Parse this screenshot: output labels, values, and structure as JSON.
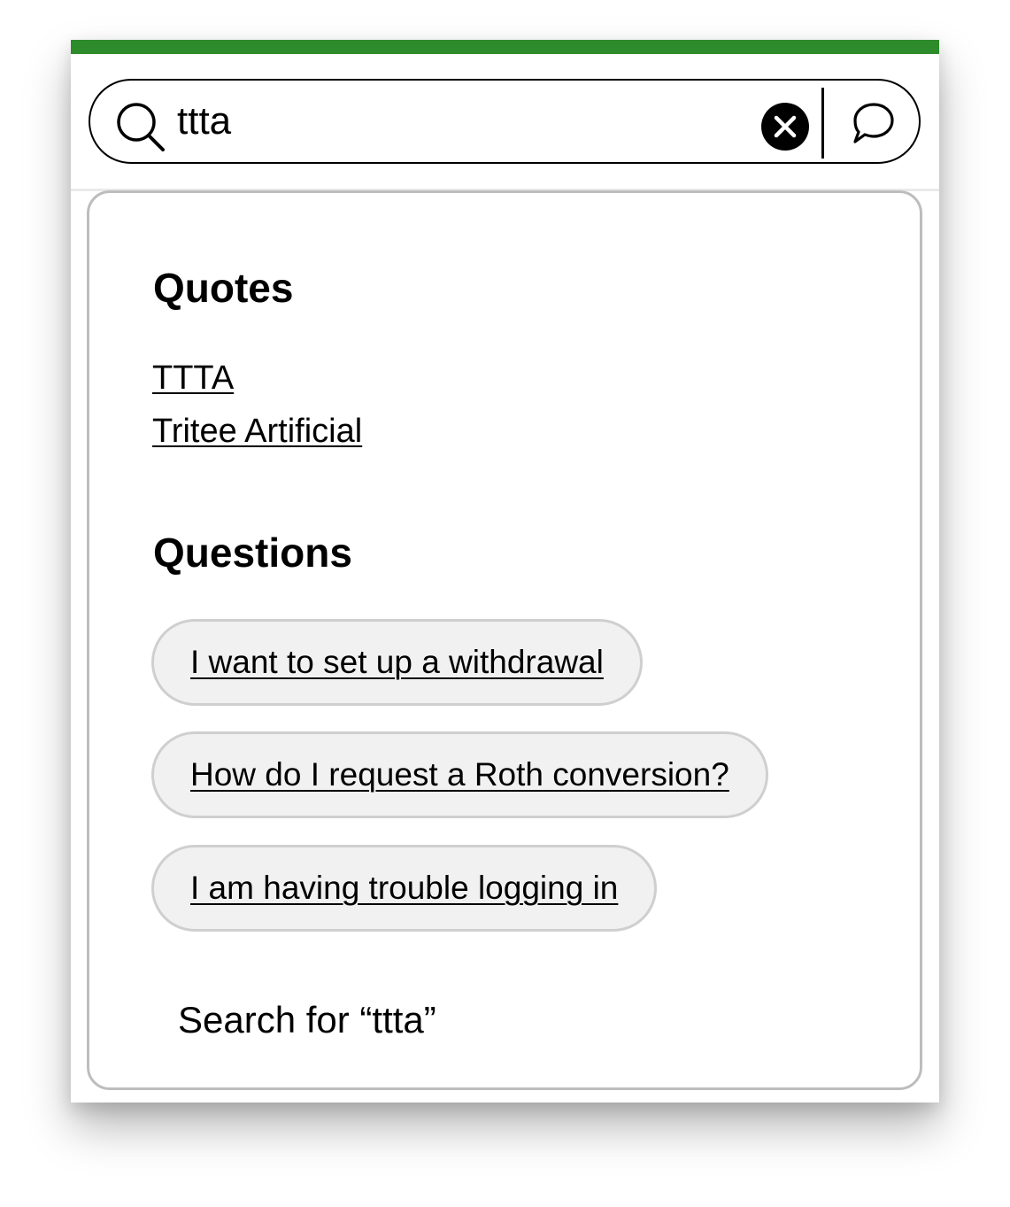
{
  "colors": {
    "accent": "#2e8b2b",
    "chip_background": "#f1f1f1",
    "dropdown_border": "#bdbdbd"
  },
  "search": {
    "value": "ttta",
    "search_icon": "search-icon",
    "clear_icon": "close-circle-icon",
    "chat_icon": "chat-bubble-icon"
  },
  "quotes": {
    "heading": "Quotes",
    "items": [
      {
        "label": "TTTA"
      },
      {
        "label": "Tritee Artificial"
      }
    ]
  },
  "questions": {
    "heading": "Questions",
    "items": [
      {
        "label": "I want to set up a withdrawal"
      },
      {
        "label": "How do I request a Roth conversion?"
      },
      {
        "label": "I am having trouble logging in"
      }
    ]
  },
  "search_for": {
    "label": "Search for “ttta”"
  }
}
